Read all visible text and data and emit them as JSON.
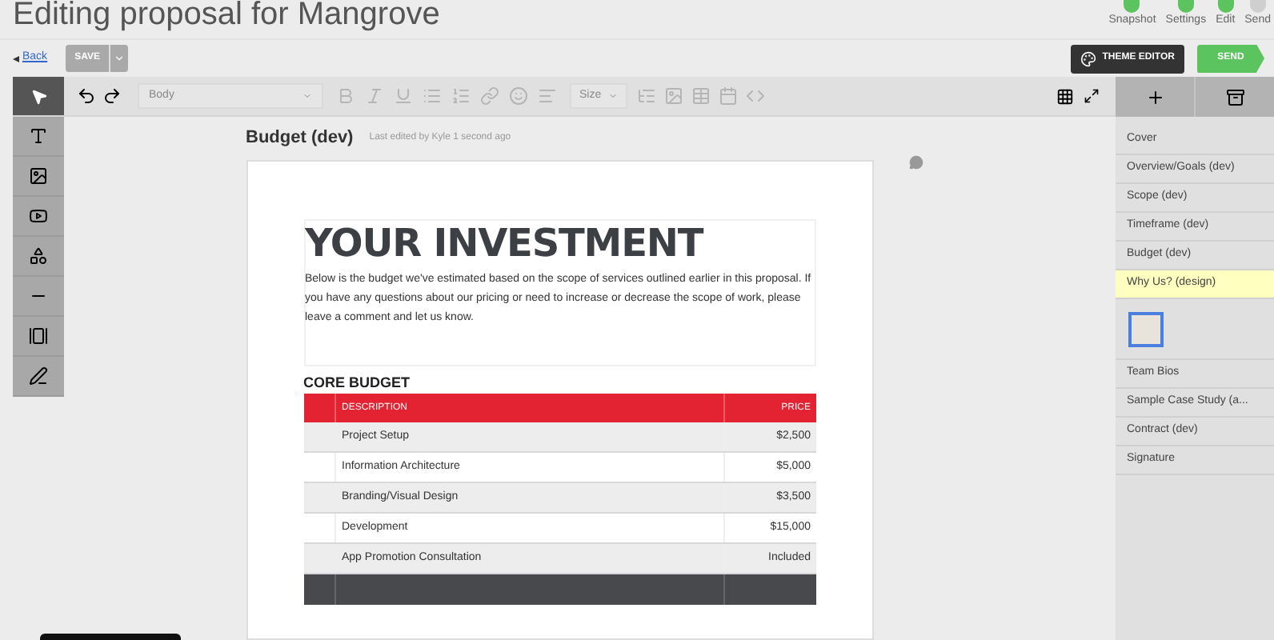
{
  "window": {
    "title": "Editing proposal for Mangrove"
  },
  "steps": [
    {
      "label": "Snapshot",
      "done": true
    },
    {
      "label": "Settings",
      "done": true
    },
    {
      "label": "Edit",
      "done": true
    },
    {
      "label": "Send",
      "done": false
    }
  ],
  "action_bar": {
    "back": "Back",
    "save": {
      "label": "SAVE",
      "disabled": true
    },
    "theme_editor": "THEME EDITOR",
    "send": "SEND"
  },
  "toolbar": {
    "style_select": "Body",
    "size_select": "Size"
  },
  "section": {
    "title": "Budget (dev)",
    "edited": "Last edited by Kyle 1 second ago"
  },
  "document": {
    "heading": "YOUR INVESTMENT",
    "intro": "Below is the budget we've estimated based on the scope of services outlined earlier in this proposal. If you have any questions about our pricing or need to increase or decrease the scope of work, please leave a comment and let us know.",
    "table_title": "CORE BUDGET",
    "table": {
      "columns": [
        "DESCRIPTION",
        "PRICE"
      ],
      "rows": [
        [
          "Project Setup",
          "$2,500"
        ],
        [
          "Information Architecture",
          "$5,000"
        ],
        [
          "Branding/Visual Design",
          "$3,500"
        ],
        [
          "Development",
          "$15,000"
        ],
        [
          "App Promotion Consultation",
          "Included"
        ]
      ]
    }
  },
  "sidebar": {
    "items": [
      {
        "label": "Cover",
        "selected": false,
        "kind": "section"
      },
      {
        "label": "Overview/Goals (dev)",
        "selected": false,
        "kind": "section"
      },
      {
        "label": "Scope (dev)",
        "selected": false,
        "kind": "section"
      },
      {
        "label": "Timeframe (dev)",
        "selected": false,
        "kind": "section"
      },
      {
        "label": "Budget (dev)",
        "selected": false,
        "kind": "section"
      },
      {
        "label": "Why Us? (design)",
        "selected": true,
        "kind": "section"
      },
      {
        "kind": "thumbnail",
        "selected": false
      },
      {
        "label": "Team Bios",
        "selected": false,
        "kind": "section"
      },
      {
        "label": "Sample Case Study (a...",
        "selected": false,
        "kind": "section"
      },
      {
        "label": "Contract (dev)",
        "selected": false,
        "kind": "section"
      },
      {
        "label": "Signature",
        "selected": false,
        "kind": "section"
      }
    ]
  }
}
